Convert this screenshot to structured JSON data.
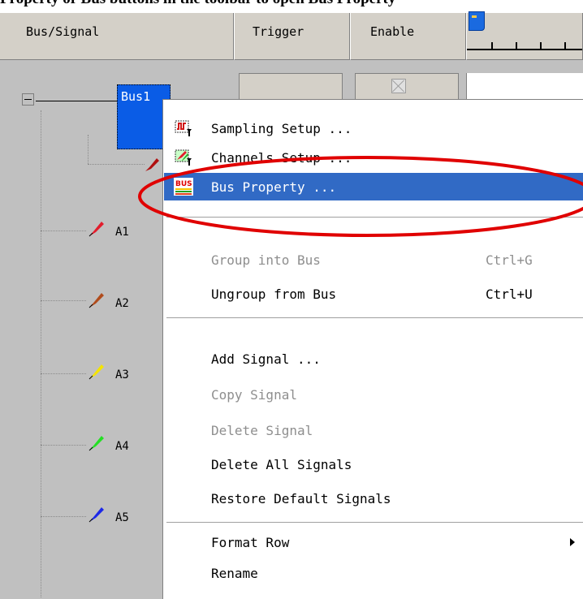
{
  "caption": {
    "text": "Property or Bus buttons in the toolbar to open Bus Property"
  },
  "columns": {
    "bus_signal": "Bus/Signal",
    "trigger": "Trigger",
    "enable": "Enable"
  },
  "tree": {
    "bus_label": "Bus1",
    "signals": [
      {
        "label": "A1",
        "color": "#e21c2c"
      },
      {
        "label": "A2",
        "color": "#b04c1c"
      },
      {
        "label": "A3",
        "color": "#f4e400"
      },
      {
        "label": "A4",
        "color": "#24e024"
      },
      {
        "label": "A5",
        "color": "#1c28e8"
      }
    ]
  },
  "menu": {
    "items": [
      {
        "label": "Sampling Setup ...",
        "icon": "sampling-setup-icon"
      },
      {
        "label": "Channels Setup ...",
        "icon": "channels-setup-icon"
      },
      {
        "label": "Bus Property ...",
        "icon": "bus-property-icon",
        "selected": true,
        "icon_text": "BUS"
      },
      {
        "label": "Group into Bus",
        "shortcut": "Ctrl+G",
        "disabled": true
      },
      {
        "label": "Ungroup from Bus",
        "shortcut": "Ctrl+U"
      },
      {
        "label": "Add Signal ..."
      },
      {
        "label": "Copy Signal",
        "disabled": true
      },
      {
        "label": "Delete Signal",
        "disabled": true
      },
      {
        "label": "Delete All Signals"
      },
      {
        "label": "Restore Default Signals"
      },
      {
        "label": "Format Row",
        "submenu": true
      },
      {
        "label": "Rename"
      }
    ]
  },
  "colors": {
    "selection": "#316ac5",
    "highlight_ellipse": "#e00000",
    "tree_background": "#c0c0c0",
    "menu_background": "#ffffff",
    "disabled_text": "#8e8e8e"
  }
}
